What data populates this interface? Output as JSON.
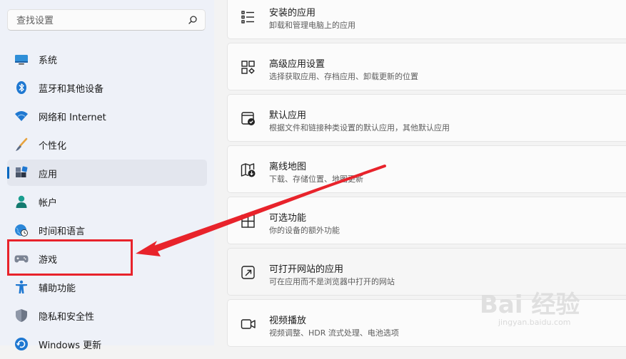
{
  "search": {
    "placeholder": "查找设置"
  },
  "sidebar": {
    "items": [
      {
        "label": "系统",
        "icon": "system-icon"
      },
      {
        "label": "蓝牙和其他设备",
        "icon": "bluetooth-icon"
      },
      {
        "label": "网络和 Internet",
        "icon": "wifi-icon"
      },
      {
        "label": "个性化",
        "icon": "brush-icon"
      },
      {
        "label": "应用",
        "icon": "apps-icon",
        "selected": true
      },
      {
        "label": "帐户",
        "icon": "account-icon"
      },
      {
        "label": "时间和语言",
        "icon": "globe-clock-icon"
      },
      {
        "label": "游戏",
        "icon": "gamepad-icon"
      },
      {
        "label": "辅助功能",
        "icon": "accessibility-icon"
      },
      {
        "label": "隐私和安全性",
        "icon": "shield-icon"
      },
      {
        "label": "Windows 更新",
        "icon": "update-icon"
      }
    ]
  },
  "cards": [
    {
      "title": "安装的应用",
      "subtitle": "卸载和管理电脑上的应用",
      "icon": "installed-apps-icon"
    },
    {
      "title": "高级应用设置",
      "subtitle": "选择获取应用、存档应用、卸载更新的位置",
      "icon": "advanced-apps-icon"
    },
    {
      "title": "默认应用",
      "subtitle": "根据文件和链接种类设置的默认应用，其他默认应用",
      "icon": "default-apps-icon"
    },
    {
      "title": "离线地图",
      "subtitle": "下载、存储位置、地图更新",
      "icon": "offline-maps-icon"
    },
    {
      "title": "可选功能",
      "subtitle": "你的设备的额外功能",
      "icon": "optional-features-icon"
    },
    {
      "title": "可打开网站的应用",
      "subtitle": "可在应用而不是浏览器中打开的网站",
      "icon": "apps-for-websites-icon"
    },
    {
      "title": "视频播放",
      "subtitle": "视频调整、HDR 流式处理、电池选项",
      "icon": "video-playback-icon"
    }
  ],
  "watermark": {
    "brand": "Bai 经验",
    "url": "jingyan.baidu.com"
  },
  "colors": {
    "accent": "#0067c0",
    "annotation": "#e8232b"
  }
}
